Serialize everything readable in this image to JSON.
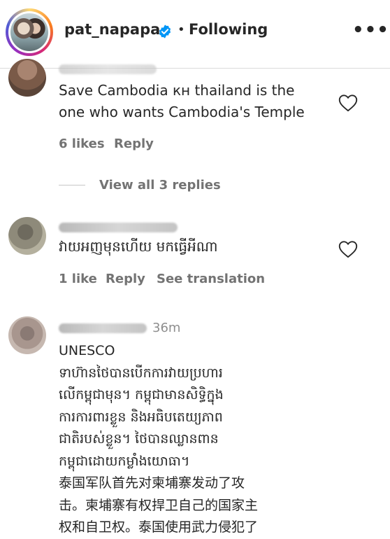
{
  "header": {
    "username": "pat_napapa",
    "dot": "•",
    "following_label": "Following",
    "more_label": "•••"
  },
  "comments": [
    {
      "text": "Save Cambodia кн thailand is the\none who wants Cambodia's Temple",
      "likes_label": "6 likes",
      "reply_label": "Reply",
      "view_replies_label": "View all 3 replies"
    },
    {
      "text": "វាយអញមុនហើយ មកធ្វើអីណា",
      "likes_label": "1 like",
      "reply_label": "Reply",
      "translation_label": "See translation"
    },
    {
      "time": "36m",
      "text": "UNESCO\nទាហ៊ានថៃបានបើកការវាយប្រហារ\nលើកម្ពុជាមុន។ កម្ពុជាមានសិទ្ធិក្នុង\nការការពារខ្លួន និងអធិបតេយ្យភាព\nជាតិរបស់ខ្លួន។ ថៃបានឈ្លានពាន\nកម្ពុជាដោយកម្លាំងយោធា។\n泰国军队首先对柬埔寨发动了攻\n击。柬埔寨有权捍卫自己的国家主\n权和自卫权。泰国使用武力侵犯了"
    }
  ],
  "colors": {
    "text": "#262626",
    "secondary": "#737373",
    "verified_blue": "#0095f6"
  }
}
